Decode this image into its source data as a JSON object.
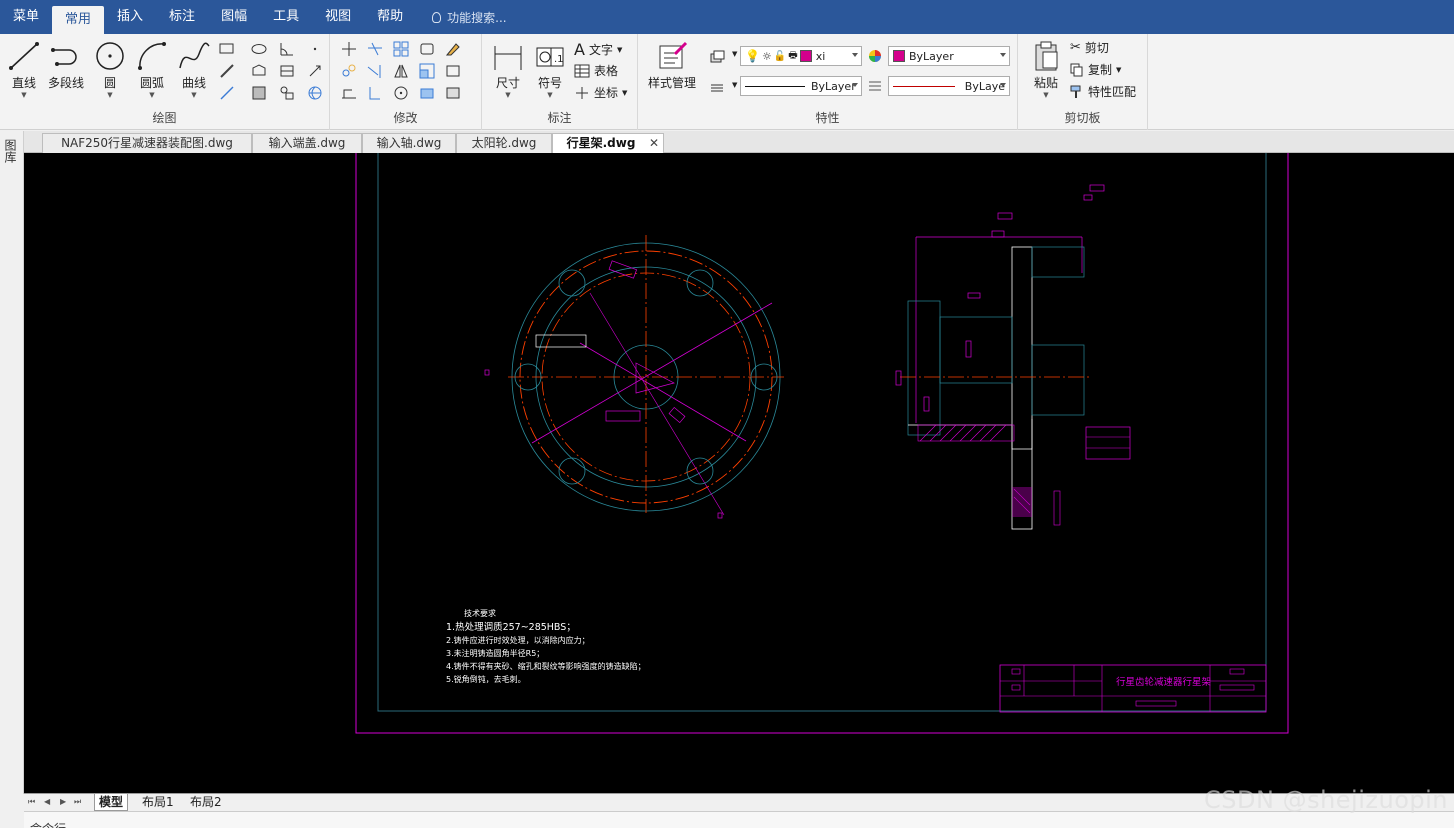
{
  "menubar": {
    "items": [
      "菜单",
      "常用",
      "插入",
      "标注",
      "图幅",
      "工具",
      "视图",
      "帮助"
    ],
    "active_index": 1,
    "search_placeholder": "功能搜索..."
  },
  "ribbon": {
    "draw": {
      "label": "绘图",
      "buttons": [
        "直线",
        "多段线",
        "圆",
        "圆弧",
        "曲线"
      ]
    },
    "modify": {
      "label": "修改"
    },
    "annotate": {
      "label": "标注",
      "buttons": [
        "尺寸",
        "符号"
      ],
      "small": [
        "文字",
        "表格",
        "坐标"
      ]
    },
    "properties": {
      "label": "特性",
      "style_button": "样式管理",
      "layer_value": "xi",
      "color_value": "ByLayer",
      "linetype_value": "ByLayer",
      "lineweight_value": "ByLaye",
      "accent_color": "#d4008c"
    },
    "clipboard": {
      "label": "剪切板",
      "paste": "粘贴",
      "cut": "剪切",
      "copy": "复制",
      "match": "特性匹配"
    }
  },
  "sidetab": {
    "label": "图库"
  },
  "filetabs": [
    {
      "label": "NAF250行星减速器装配图.dwg",
      "active": false
    },
    {
      "label": "输入端盖.dwg",
      "active": false
    },
    {
      "label": "输入轴.dwg",
      "active": false
    },
    {
      "label": "太阳轮.dwg",
      "active": false
    },
    {
      "label": "行星架.dwg",
      "active": true
    }
  ],
  "drawing": {
    "tech_req_title": "技术要求",
    "tech_req_lines": [
      "1.热处理调质257~285HBS；",
      "2.铸件应进行时效处理，以消除内应力；",
      "3.未注明铸造圆角半径R5；",
      "4.铸件不得有夹砂、缩孔和裂纹等影响强度的铸造缺陷；",
      "5.锐角倒钝，去毛刺。"
    ],
    "title_block_name": "行星齿轮减速器行星架",
    "colors": {
      "frame": "#d400d4",
      "center": "#ff4000",
      "white": "#ffffff",
      "cyan": "#00a0a0",
      "inner_frame": "#2a6a7a"
    }
  },
  "layouttabs": [
    "模型",
    "布局1",
    "布局2"
  ],
  "cmdline": {
    "text": "命令行"
  },
  "watermark": "CSDN @shejizuopin"
}
